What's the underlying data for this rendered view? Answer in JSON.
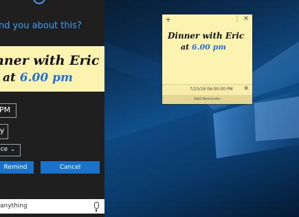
{
  "cortana": {
    "prompt": "nd you about this?",
    "note_line1": "nner with Eric",
    "note_line2_prefix": "at ",
    "note_time": "6.00 pm",
    "time_value": "PM",
    "day_value": "ay",
    "repeat_value": "nce",
    "remind_label": "Remind",
    "cancel_label": "Cancel",
    "ask_text": "anything"
  },
  "sticky": {
    "line1": "Dinner with Eric",
    "line2_prefix": "at ",
    "time": "6.00 pm",
    "reminder_datetime": "7/15/16 06:00:00 PM",
    "add_reminder_label": "Add Reminder"
  },
  "colors": {
    "accent": "#1a73c9",
    "note_yellow": "#fdf3b0",
    "panel_bg": "#1f1f1f"
  }
}
